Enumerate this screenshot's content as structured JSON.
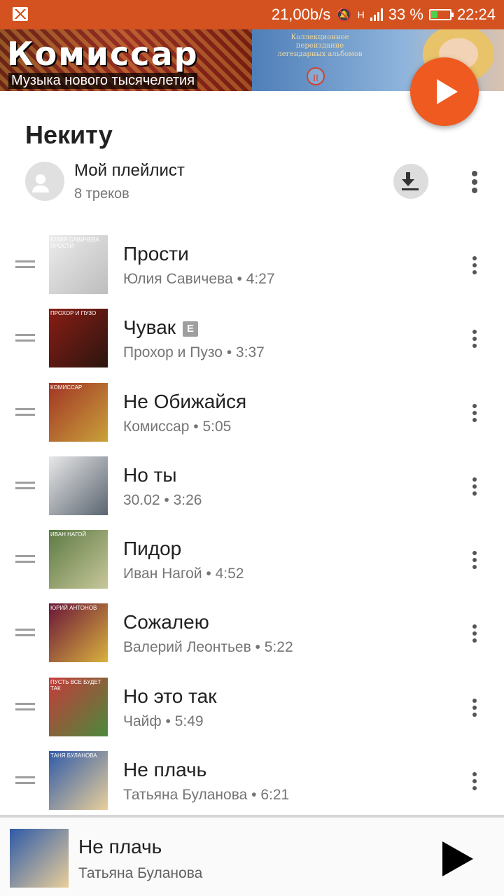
{
  "status_bar": {
    "speed": "21,00b/s",
    "network": "H",
    "battery": "33 %",
    "battery_level": 0.33,
    "time": "22:24",
    "color": "#d4521f"
  },
  "banner": {
    "logo_text": "Комиссар",
    "subtitle": "Музыка нового тысячелетия",
    "collection_text": "Коллекционное переиздание легендарных альбомов",
    "badge": "II"
  },
  "playlist": {
    "owner": "Некиту",
    "name": "Мой плейлист",
    "track_count": "8 треков"
  },
  "tracks": [
    {
      "title": "Прости",
      "sub": "Юлия Савичева • 4:27",
      "explicit": false,
      "cover_colors": [
        "#ececec",
        "#bdbdbd"
      ],
      "cover_text": "Юлия Савичева прости"
    },
    {
      "title": "Чувак",
      "sub": "Прохор и Пузо • 3:37",
      "explicit": true,
      "explicit_label": "E",
      "cover_colors": [
        "#8a1d14",
        "#2b1510"
      ],
      "cover_text": "Прохор и Пузо"
    },
    {
      "title": "Не Обижайся",
      "sub": "Комиссар • 5:05",
      "explicit": false,
      "cover_colors": [
        "#a13425",
        "#c9a23a"
      ],
      "cover_text": "Комиссар"
    },
    {
      "title": "Но ты",
      "sub": "30.02 • 3:26",
      "explicit": false,
      "cover_colors": [
        "#e8e8e8",
        "#5a6470"
      ],
      "cover_text": ""
    },
    {
      "title": "Пидор",
      "sub": "Иван Нагой • 4:52",
      "explicit": false,
      "cover_colors": [
        "#5c7a43",
        "#c8c79a"
      ],
      "cover_text": "Иван Нагой"
    },
    {
      "title": "Сожалею",
      "sub": "Валерий Леонтьев • 5:22",
      "explicit": false,
      "cover_colors": [
        "#6a1438",
        "#d9b23e"
      ],
      "cover_text": "Юрий Антонов"
    },
    {
      "title": "Но это так",
      "sub": "Чайф • 5:49",
      "explicit": false,
      "cover_colors": [
        "#c63a3a",
        "#4b8a3c"
      ],
      "cover_text": "Пусть все будет так"
    },
    {
      "title": "Не плачь",
      "sub": "Татьяна Буланова • 6:21",
      "explicit": false,
      "cover_colors": [
        "#2f5aa8",
        "#e9cf9a"
      ],
      "cover_text": "Таня Буланова"
    }
  ],
  "now_playing": {
    "title": "Не плачь",
    "artist": "Татьяна Буланова",
    "cover_colors": [
      "#2f5aa8",
      "#e9cf9a"
    ]
  },
  "accent_color": "#ef5a20"
}
